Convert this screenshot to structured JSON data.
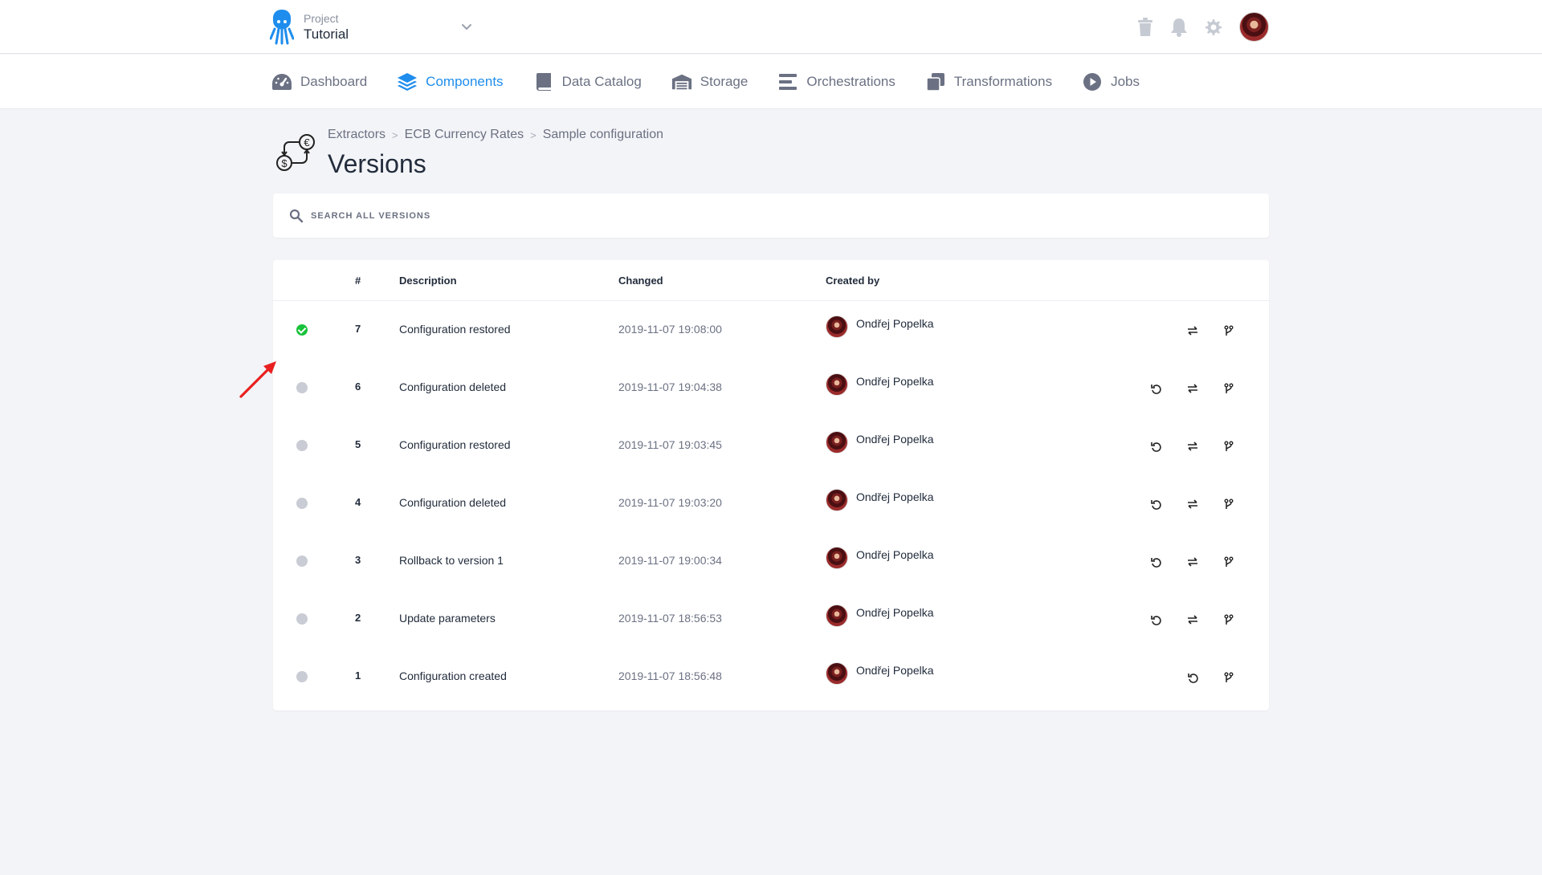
{
  "header": {
    "project_label": "Project",
    "project_name": "Tutorial",
    "icons": [
      "trash-icon",
      "bell-icon",
      "gear-icon",
      "user-avatar"
    ]
  },
  "nav": {
    "items": [
      {
        "label": "Dashboard",
        "icon": "dashboard-icon",
        "active": false
      },
      {
        "label": "Components",
        "icon": "layers-icon",
        "active": true
      },
      {
        "label": "Data Catalog",
        "icon": "book-icon",
        "active": false
      },
      {
        "label": "Storage",
        "icon": "warehouse-icon",
        "active": false
      },
      {
        "label": "Orchestrations",
        "icon": "bars-icon",
        "active": false
      },
      {
        "label": "Transformations",
        "icon": "copy-icon",
        "active": false
      },
      {
        "label": "Jobs",
        "icon": "play-circle-icon",
        "active": false
      }
    ]
  },
  "breadcrumb": [
    "Extractors",
    "ECB Currency Rates",
    "Sample configuration"
  ],
  "page_title": "Versions",
  "search": {
    "placeholder": "SEARCH ALL VERSIONS",
    "value": ""
  },
  "table": {
    "columns": [
      "#",
      "Description",
      "Changed",
      "Created by"
    ],
    "rows": [
      {
        "num": "7",
        "description": "Configuration restored",
        "changed": "2019-11-07 19:08:00",
        "user": "Ondřej Popelka",
        "current": true
      },
      {
        "num": "6",
        "description": "Configuration deleted",
        "changed": "2019-11-07 19:04:38",
        "user": "Ondřej Popelka",
        "current": false
      },
      {
        "num": "5",
        "description": "Configuration restored",
        "changed": "2019-11-07 19:03:45",
        "user": "Ondřej Popelka",
        "current": false
      },
      {
        "num": "4",
        "description": "Configuration deleted",
        "changed": "2019-11-07 19:03:20",
        "user": "Ondřej Popelka",
        "current": false
      },
      {
        "num": "3",
        "description": "Rollback to version 1",
        "changed": "2019-11-07 19:00:34",
        "user": "Ondřej Popelka",
        "current": false
      },
      {
        "num": "2",
        "description": "Update parameters",
        "changed": "2019-11-07 18:56:53",
        "user": "Ondřej Popelka",
        "current": false
      },
      {
        "num": "1",
        "description": "Configuration created",
        "changed": "2019-11-07 18:56:48",
        "user": "Ondřej Popelka",
        "current": false
      }
    ]
  },
  "colors": {
    "accent": "#1e8ded",
    "current_version": "#18c23a",
    "annotation_arrow": "#e8201f"
  }
}
